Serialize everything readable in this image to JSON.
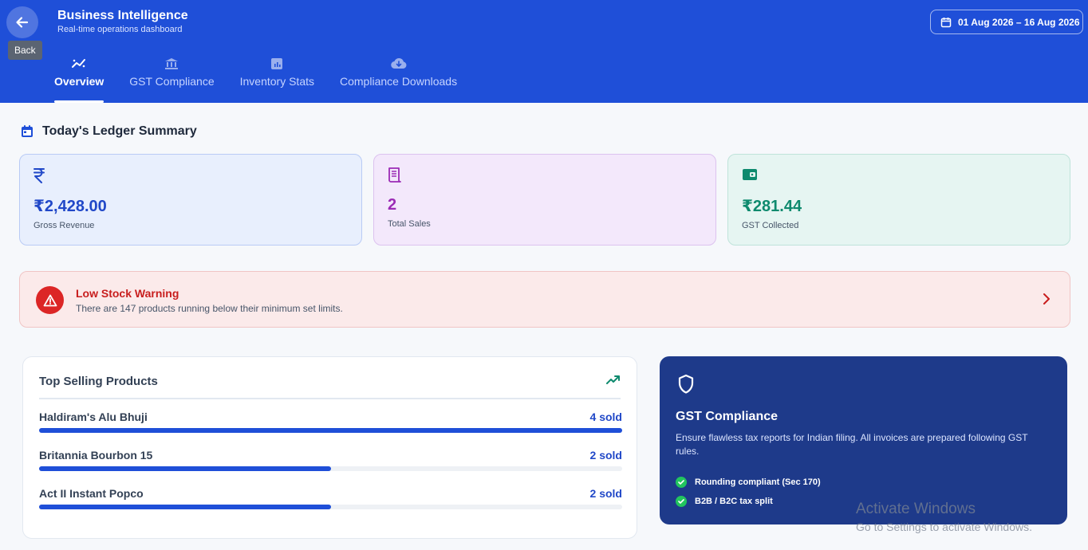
{
  "header": {
    "back_tooltip": "Back",
    "title": "Business Intelligence",
    "subtitle": "Real-time operations dashboard",
    "date_range": "01 Aug 2026 – 16 Aug 2026",
    "tabs": [
      {
        "label": "Overview",
        "icon": "trend-icon",
        "active": true
      },
      {
        "label": "GST Compliance",
        "icon": "bank-icon",
        "active": false
      },
      {
        "label": "Inventory Stats",
        "icon": "bar-chart-icon",
        "active": false
      },
      {
        "label": "Compliance Downloads",
        "icon": "cloud-download-icon",
        "active": false
      }
    ]
  },
  "ledger": {
    "title": "Today's Ledger Summary",
    "cards": [
      {
        "value": "₹2,428.00",
        "label": "Gross Revenue",
        "icon": "rupee-icon",
        "color": "#2148c8"
      },
      {
        "value": "2",
        "label": "Total Sales",
        "icon": "receipt-icon",
        "color": "#9b2bb5"
      },
      {
        "value": "₹281.44",
        "label": "GST Collected",
        "icon": "wallet-icon",
        "color": "#0e8a6e"
      }
    ]
  },
  "warning": {
    "title": "Low Stock Warning",
    "text": "There are 147 products running below their minimum set limits."
  },
  "top_selling": {
    "title": "Top Selling Products",
    "products": [
      {
        "name": "Haldiram's Alu Bhuji",
        "sold": "4 sold",
        "share": 1.0
      },
      {
        "name": "Britannia Bourbon 15",
        "sold": "2 sold",
        "share": 0.5
      },
      {
        "name": "Act II Instant Popco",
        "sold": "2 sold",
        "share": 0.5
      }
    ]
  },
  "gst": {
    "title": "GST Compliance",
    "description": "Ensure flawless tax reports for Indian filing. All invoices are prepared following GST rules.",
    "checks": [
      "Rounding compliant (Sec 170)",
      "B2B / B2C tax split"
    ]
  },
  "watermark": {
    "title": "Activate Windows",
    "subtitle": "Go to Settings to activate Windows."
  },
  "colors": {
    "primary": "#1f4fd8",
    "danger": "#dc2626",
    "success": "#22c55e",
    "navy": "#1e3a8a"
  }
}
